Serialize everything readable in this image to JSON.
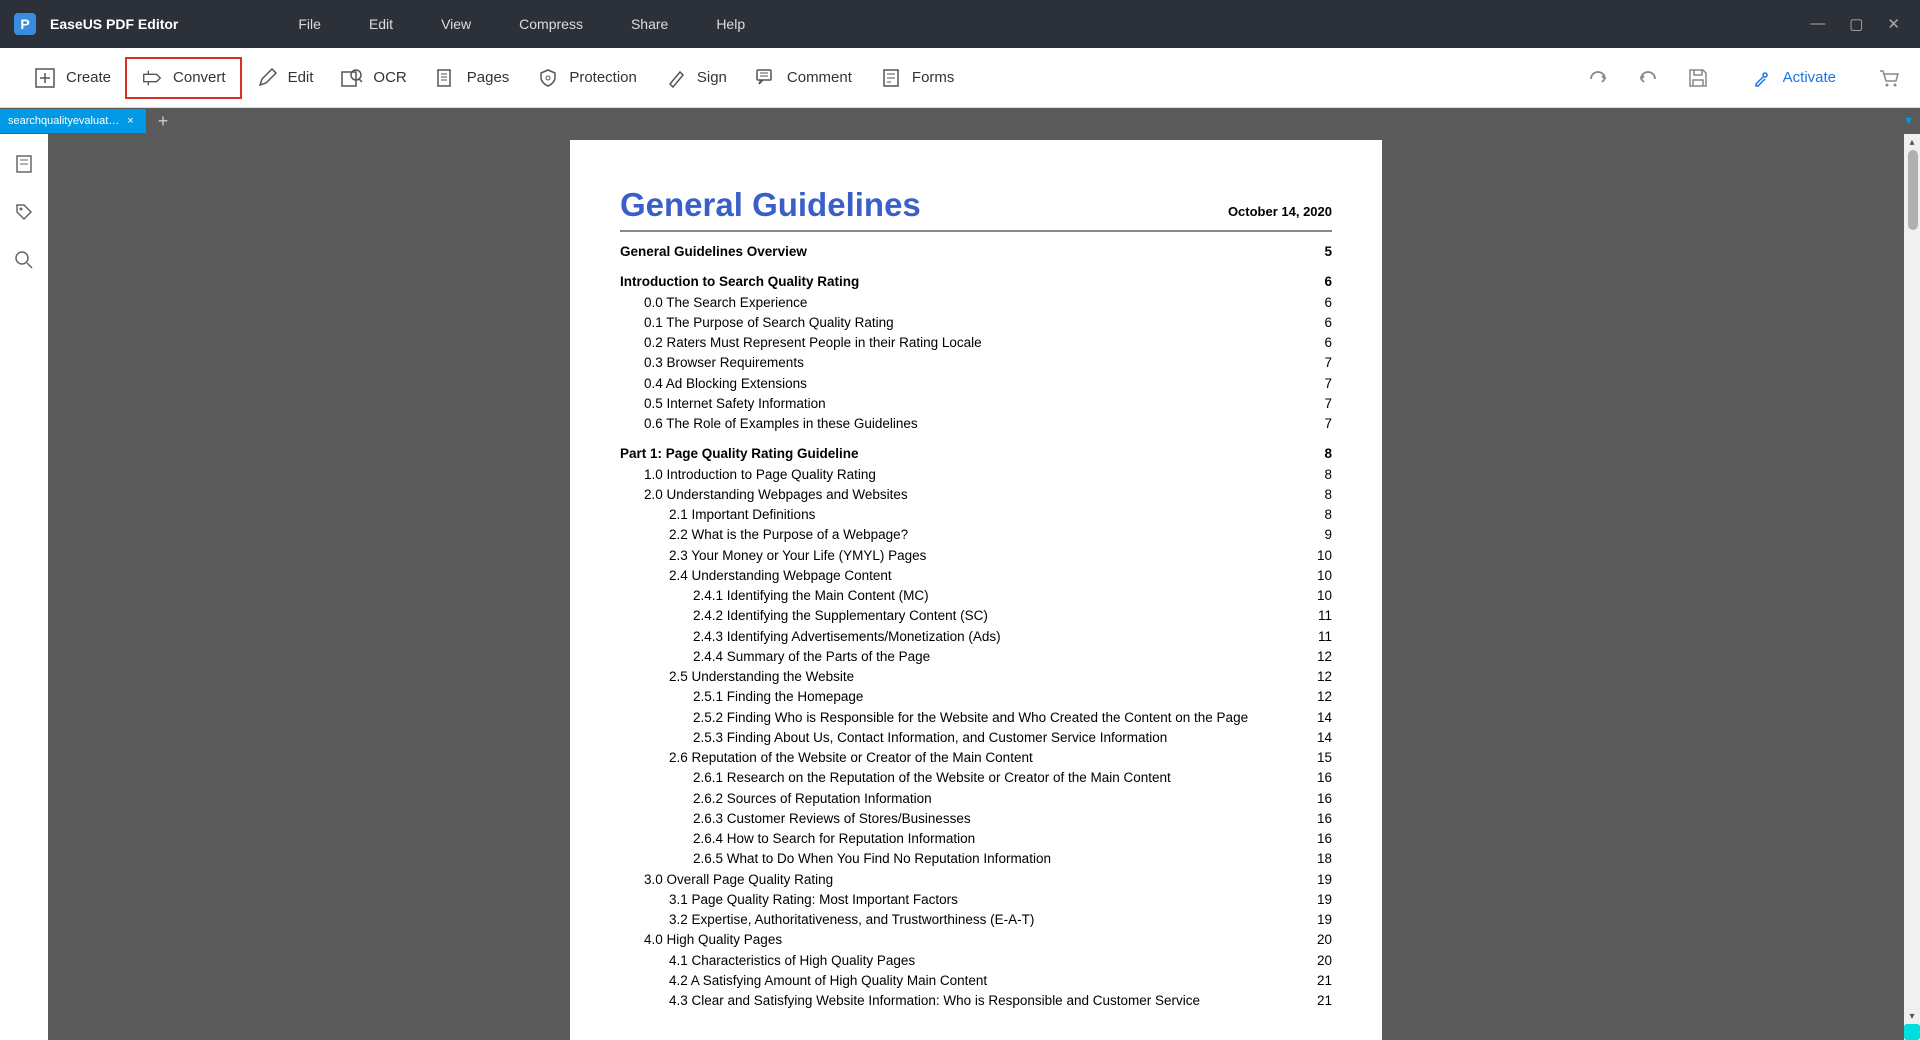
{
  "app": {
    "title": "EaseUS PDF Editor",
    "logo": "P"
  },
  "menu": [
    "File",
    "Edit",
    "View",
    "Compress",
    "Share",
    "Help"
  ],
  "win_controls": {
    "min": "—",
    "max": "▢",
    "close": "✕"
  },
  "toolbar": {
    "create": "Create",
    "convert": "Convert",
    "edit": "Edit",
    "ocr": "OCR",
    "pages": "Pages",
    "protection": "Protection",
    "sign": "Sign",
    "comment": "Comment",
    "forms": "Forms",
    "activate": "Activate"
  },
  "tab": {
    "name": "searchqualityevaluat…",
    "close": "×",
    "add": "+"
  },
  "document": {
    "title": "General Guidelines",
    "date": "October 14, 2020",
    "toc": [
      {
        "level": 0,
        "text": "General Guidelines Overview",
        "page": "5"
      },
      {
        "level": 0,
        "text": "Introduction to Search Quality Rating",
        "page": "6"
      },
      {
        "level": 1,
        "text": "0.0 The Search Experience",
        "page": "6"
      },
      {
        "level": 1,
        "text": "0.1 The Purpose of Search Quality Rating",
        "page": "6"
      },
      {
        "level": 1,
        "text": "0.2 Raters Must Represent People in their Rating Locale",
        "page": "6"
      },
      {
        "level": 1,
        "text": "0.3 Browser Requirements",
        "page": "7"
      },
      {
        "level": 1,
        "text": "0.4 Ad Blocking Extensions",
        "page": "7"
      },
      {
        "level": 1,
        "text": "0.5 Internet Safety Information",
        "page": "7"
      },
      {
        "level": 1,
        "text": "0.6 The Role of Examples in these Guidelines",
        "page": "7"
      },
      {
        "level": 0,
        "text": "Part 1: Page Quality Rating Guideline",
        "page": "8"
      },
      {
        "level": 1,
        "text": "1.0 Introduction to Page Quality Rating",
        "page": "8"
      },
      {
        "level": 1,
        "text": "2.0 Understanding Webpages and Websites",
        "page": "8"
      },
      {
        "level": 2,
        "text": "2.1 Important Definitions",
        "page": "8"
      },
      {
        "level": 2,
        "text": "2.2 What is the Purpose of a Webpage?",
        "page": "9"
      },
      {
        "level": 2,
        "text": "2.3 Your Money or Your Life (YMYL) Pages",
        "page": "10"
      },
      {
        "level": 2,
        "text": "2.4 Understanding Webpage Content",
        "page": "10"
      },
      {
        "level": 3,
        "text": "2.4.1 Identifying the Main Content (MC)",
        "page": "10"
      },
      {
        "level": 3,
        "text": "2.4.2 Identifying the Supplementary Content (SC)",
        "page": "11"
      },
      {
        "level": 3,
        "text": "2.4.3 Identifying Advertisements/Monetization (Ads)",
        "page": "11"
      },
      {
        "level": 3,
        "text": "2.4.4 Summary of the Parts of the Page",
        "page": "12"
      },
      {
        "level": 2,
        "text": "2.5 Understanding the Website",
        "page": "12"
      },
      {
        "level": 3,
        "text": "2.5.1 Finding the Homepage",
        "page": "12"
      },
      {
        "level": 3,
        "text": "2.5.2 Finding Who is Responsible for the Website and Who Created the Content on the Page",
        "page": "14"
      },
      {
        "level": 3,
        "text": "2.5.3 Finding About Us, Contact Information, and Customer Service Information",
        "page": "14"
      },
      {
        "level": 2,
        "text": "2.6 Reputation of the Website or Creator of the Main Content",
        "page": "15"
      },
      {
        "level": 3,
        "text": "2.6.1 Research on the Reputation of the Website or Creator of the Main Content",
        "page": "16"
      },
      {
        "level": 3,
        "text": "2.6.2 Sources of Reputation Information",
        "page": "16"
      },
      {
        "level": 3,
        "text": "2.6.3 Customer Reviews of Stores/Businesses",
        "page": "16"
      },
      {
        "level": 3,
        "text": "2.6.4 How to Search for Reputation Information",
        "page": "16"
      },
      {
        "level": 3,
        "text": "2.6.5 What to Do When You Find No Reputation Information",
        "page": "18"
      },
      {
        "level": 1,
        "text": "3.0 Overall Page Quality Rating",
        "page": "19"
      },
      {
        "level": 2,
        "text": "3.1 Page Quality Rating: Most Important Factors",
        "page": "19"
      },
      {
        "level": 2,
        "text": "3.2 Expertise, Authoritativeness, and Trustworthiness (E-A-T)",
        "page": "19"
      },
      {
        "level": 1,
        "text": "4.0 High Quality Pages",
        "page": "20"
      },
      {
        "level": 2,
        "text": "4.1 Characteristics of High Quality Pages",
        "page": "20"
      },
      {
        "level": 2,
        "text": "4.2 A Satisfying Amount of High Quality Main Content",
        "page": "21"
      },
      {
        "level": 2,
        "text": "4.3 Clear and Satisfying Website Information: Who is Responsible and Customer Service",
        "page": "21"
      }
    ]
  }
}
